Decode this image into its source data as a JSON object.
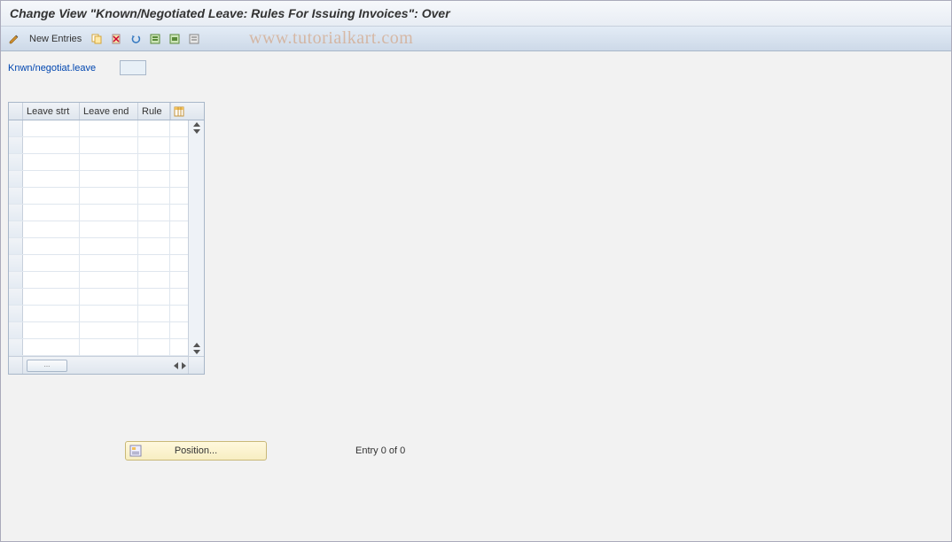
{
  "header": {
    "title": "Change View \"Known/Negotiated Leave: Rules For Issuing Invoices\": Over"
  },
  "toolbar": {
    "edit_icon": "edit-pencil",
    "new_entries_label": "New Entries",
    "copy_icon": "copy",
    "delete_icon": "delete",
    "undo_icon": "undo",
    "select_all_icon": "select-all",
    "select_block_icon": "select-block",
    "deselect_icon": "deselect"
  },
  "watermark": "www.tutorialkart.com",
  "field": {
    "label": "Knwn/negotiat.leave",
    "value": ""
  },
  "grid": {
    "columns": [
      "Leave strt",
      "Leave end",
      "Rule"
    ],
    "row_count": 14,
    "footer_btn": "..."
  },
  "footer": {
    "position_label": "Position...",
    "entry_text": "Entry 0 of 0"
  }
}
